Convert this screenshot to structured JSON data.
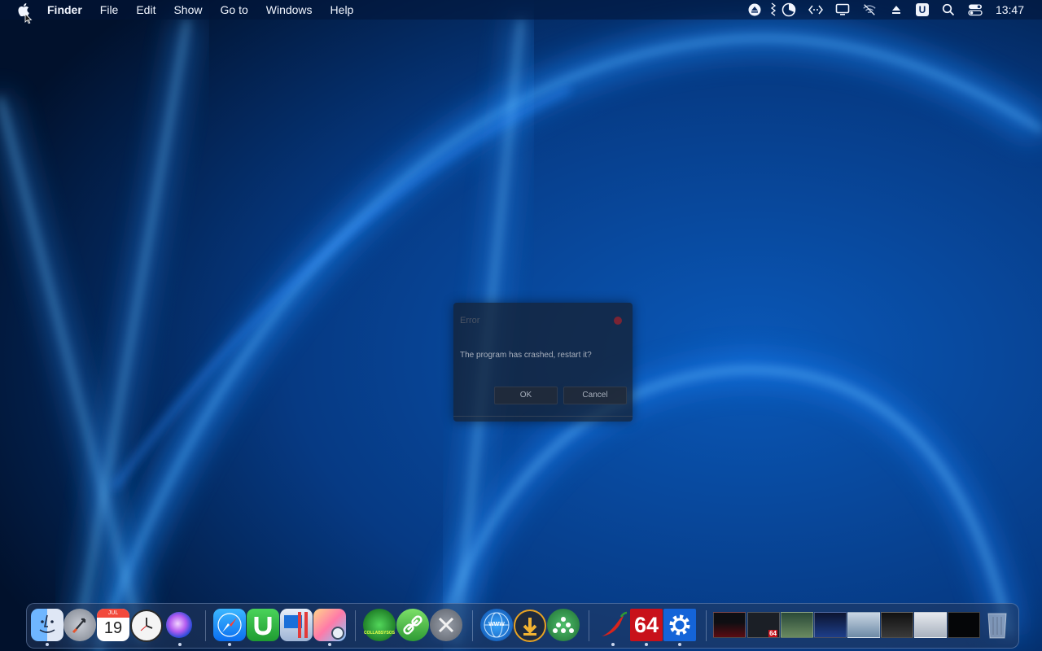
{
  "menubar": {
    "app_name": "Finder",
    "items": [
      "File",
      "Edit",
      "Show",
      "Go to",
      "Windows",
      "Help"
    ],
    "status_icons": [
      "eject-icon",
      "battery-icon",
      "pie-chart-icon",
      "code-arrows-icon",
      "display-icon",
      "wifi-off-icon",
      "upload-icon",
      "u-icon",
      "search-icon",
      "control-center-icon"
    ],
    "u_label": "U",
    "clock": "13:47"
  },
  "dialog": {
    "title": "Error",
    "message": "The program has crashed, restart it?",
    "ok_label": "OK",
    "cancel_label": "Cancel"
  },
  "dock": {
    "calendar_month": "JUL",
    "calendar_day": "19",
    "aida_label": "64",
    "collab_label": "COLLABSYSOS",
    "web_label": "WWW",
    "thumb_badge": "64",
    "apps": [
      "finder",
      "launchpad",
      "calendar",
      "clock",
      "siri",
      "safari",
      "utorrent",
      "parallels",
      "preview",
      "collabsysos",
      "link",
      "utilities",
      "web",
      "downloader",
      "drops",
      "chili",
      "aida64",
      "settings"
    ],
    "accent": "#2d8cff"
  }
}
